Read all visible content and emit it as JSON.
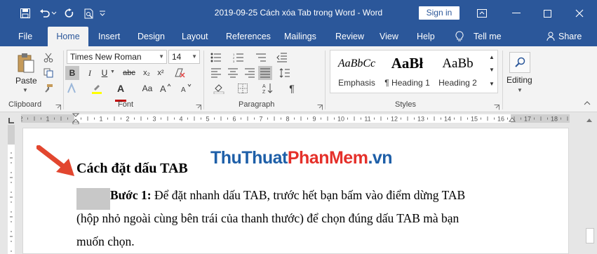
{
  "window": {
    "title": "2019-09-25 Cách xóa Tab trong Word  -  Word",
    "sign_in": "Sign in"
  },
  "tabs": [
    {
      "label": "File"
    },
    {
      "label": "Home",
      "active": true
    },
    {
      "label": "Insert"
    },
    {
      "label": "Design"
    },
    {
      "label": "Layout"
    },
    {
      "label": "References"
    },
    {
      "label": "Mailings"
    },
    {
      "label": "Review"
    },
    {
      "label": "View"
    },
    {
      "label": "Help"
    },
    {
      "label": "Tell me"
    },
    {
      "label": "Share"
    }
  ],
  "ribbon": {
    "clipboard": {
      "paste": "Paste",
      "label": "Clipboard"
    },
    "font": {
      "name": "Times New Roman",
      "size": "14",
      "label": "Font",
      "bold": "B",
      "italic": "I",
      "underline": "U",
      "strikethrough": "abc",
      "subscript": "x₂",
      "superscript": "x²",
      "font_color": "A",
      "change_case": "Aa"
    },
    "paragraph": {
      "label": "Paragraph"
    },
    "styles": {
      "label": "Styles",
      "items": [
        {
          "preview": "AaBbCc",
          "name": "Emphasis"
        },
        {
          "preview": "AaBł",
          "name": "¶ Heading 1"
        },
        {
          "preview": "AaBb",
          "name": "Heading 2"
        }
      ]
    },
    "editing": {
      "label": "Editing"
    }
  },
  "ruler": {
    "numbers": [
      "2",
      "1",
      "1",
      "2",
      "3",
      "4",
      "5",
      "6",
      "7",
      "8",
      "9",
      "10",
      "11",
      "12",
      "13",
      "14",
      "15",
      "16",
      "17",
      "18"
    ]
  },
  "document": {
    "heading": "Cách đặt dấu TAB",
    "step_label": "Bước 1:",
    "line1": " Để đặt nhanh dấu TAB, trước hết bạn bấm vào điểm dừng TAB",
    "line2": "(hộp nhỏ ngoài cùng bên trái của thanh thước) để chọn đúng dấu TAB mà bạn",
    "line3": "muốn chọn."
  },
  "watermark": {
    "part1": "ThuThuat",
    "part2": "PhanMem",
    "part3": ".vn"
  },
  "colors": {
    "title_bar": "#2b579a",
    "ribbon_bg": "#f3f3f3",
    "arrow": "#e2462f",
    "watermark_blue": "#1e5fa8",
    "watermark_red": "#e5302a",
    "highlight_yellow": "#ffff00",
    "font_color_red": "#c00000"
  }
}
